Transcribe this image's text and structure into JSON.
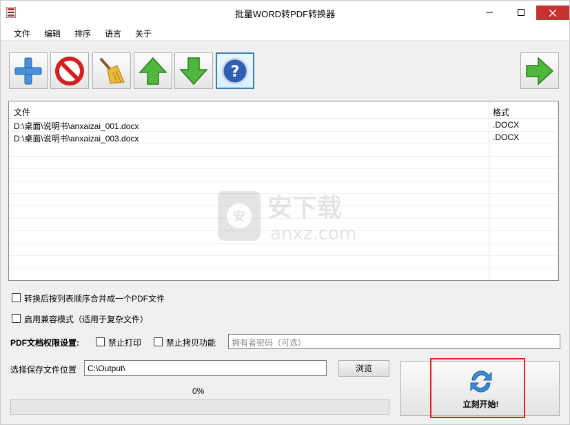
{
  "window": {
    "title": "批量WORD转PDF转换器"
  },
  "menu": [
    "文件",
    "编辑",
    "排序",
    "语言",
    "关于"
  ],
  "toolbar": {
    "icons": [
      "add-icon",
      "delete-icon",
      "clear-broom-icon",
      "move-up-icon",
      "move-down-icon",
      "help-icon",
      "next-arrow-icon"
    ]
  },
  "list": {
    "headers": {
      "file": "文件",
      "format": "格式"
    },
    "rows": [
      {
        "file": "D:\\桌面\\说明书\\anxaizai_001.docx",
        "format": ".DOCX"
      },
      {
        "file": "D:\\桌面\\说明书\\anxaizai_003.docx",
        "format": ".DOCX"
      }
    ]
  },
  "watermark": {
    "cn": "安下载",
    "en": "anxz.com",
    "badge": "安"
  },
  "options": {
    "merge_label": "转换后按列表顺序合并成一个PDF文件",
    "compat_label": "启用兼容模式（适用于复杂文件）",
    "perm_title": "PDF文档权限设置:",
    "no_print_label": "禁止打印",
    "no_copy_label": "禁止拷贝功能",
    "owner_pwd_placeholder": "拥有者密码（可选）"
  },
  "output": {
    "label": "选择保存文件位置",
    "path": "C:\\Output\\",
    "browse_label": "浏览"
  },
  "progress": {
    "text": "0%",
    "value": 0
  },
  "start": {
    "label": "立刻开始!"
  },
  "colors": {
    "close": "#c7312f",
    "highlight": "#e02020",
    "selected_border": "#3c7fb1"
  }
}
